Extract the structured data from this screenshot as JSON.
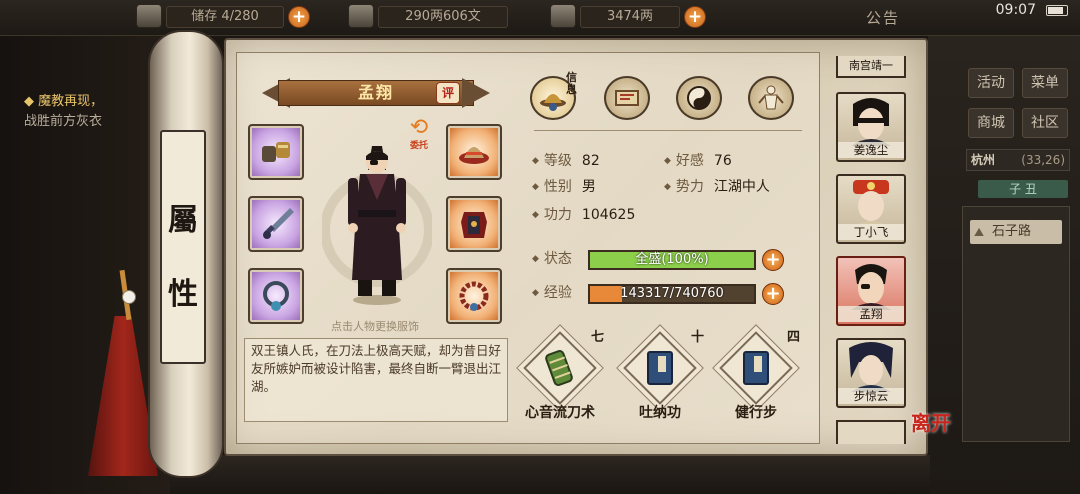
{
  "topbar": {
    "bag": "4/280",
    "bag_partial": "储存",
    "copper": "290两606文",
    "silver": "3474两",
    "announce": "公告",
    "clock": "09:07"
  },
  "quest": {
    "title": "魔教再现，",
    "sub": "战胜前方灰衣"
  },
  "right_menu": {
    "activity": "活动",
    "menu": "菜单",
    "shop": "商城",
    "community": "社区",
    "city": "杭州",
    "coords": "(33,26)",
    "hour": "子 丑",
    "road": "石子路"
  },
  "scroll": {
    "title_1": "屬",
    "title_2": "性"
  },
  "character": {
    "name": "孟翔",
    "rate_label": "评",
    "entrust_label": "委托",
    "hint": "点击人物更换服饰",
    "bio": "双王镇人氏，在刀法上极高天赋，却为昔日好友所嫉妒而被设计陷害，最终自断一臂退出江湖。"
  },
  "tabs": [
    {
      "icon": "hat-info-icon",
      "label": "信息"
    },
    {
      "icon": "scroll-icon",
      "label": ""
    },
    {
      "icon": "yin-yang-icon",
      "label": ""
    },
    {
      "icon": "meridian-icon",
      "label": ""
    }
  ],
  "stats": {
    "level_label": "等级",
    "level": "82",
    "favor_label": "好感",
    "favor": "76",
    "gender_label": "性别",
    "gender": "男",
    "faction_label": "势力",
    "faction": "江湖中人",
    "power_label": "功力",
    "power": "104625"
  },
  "status": {
    "label": "状态",
    "text": "全盛(100%)",
    "fraction": 1.0,
    "color": "#8ccf4a"
  },
  "exp": {
    "label": "经验",
    "text": "143317/740760",
    "fraction": 0.193,
    "color": "#e8893a"
  },
  "skills": [
    {
      "name": "心音流刀术",
      "level": "七",
      "icon": "scroll-bundle-icon"
    },
    {
      "name": "吐纳功",
      "level": "十",
      "icon": "book-icon"
    },
    {
      "name": "健行步",
      "level": "四",
      "icon": "book-icon"
    }
  ],
  "roster": [
    {
      "name": "南宫靖一"
    },
    {
      "name": "姜逸尘"
    },
    {
      "name": "丁小飞"
    },
    {
      "name": "孟翔"
    },
    {
      "name": "步惊云"
    }
  ],
  "leave_label": "离开",
  "colors": {
    "accent": "#e57a1e",
    "paper": "#e3d9c4",
    "frame": "#3a2d20"
  }
}
